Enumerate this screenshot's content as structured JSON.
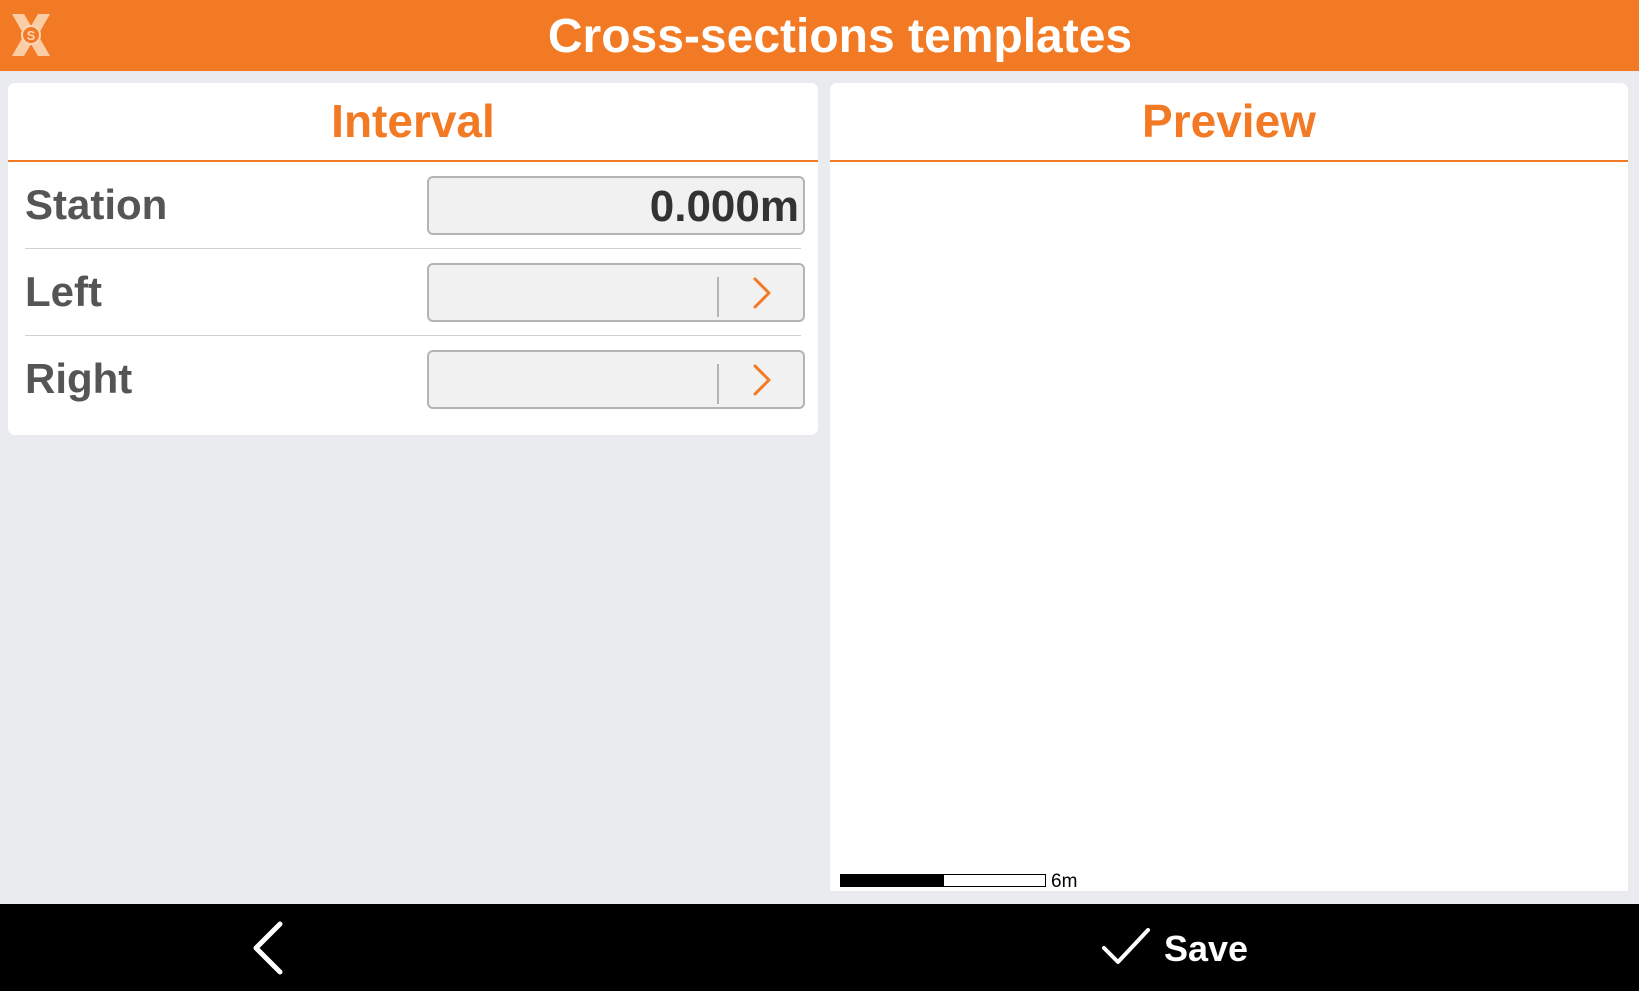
{
  "header": {
    "title": "Cross-sections templates",
    "logo_icon": "app-logo-icon",
    "background_color": "#f37a24"
  },
  "interval_panel": {
    "heading": "Interval",
    "rows": [
      {
        "label": "Station",
        "value": "0.000m"
      },
      {
        "label": "Left",
        "value": "",
        "action_icon": "chevron-right-icon"
      },
      {
        "label": "Right",
        "value": "",
        "action_icon": "chevron-right-icon"
      }
    ]
  },
  "preview_panel": {
    "heading": "Preview",
    "scale_label": "6m"
  },
  "footer": {
    "back_icon": "chevron-left-icon",
    "save_icon": "checkmark-icon",
    "save_label": "Save"
  },
  "colors": {
    "accent": "#f37a24",
    "background": "#e9ebee",
    "footer": "#000000"
  }
}
